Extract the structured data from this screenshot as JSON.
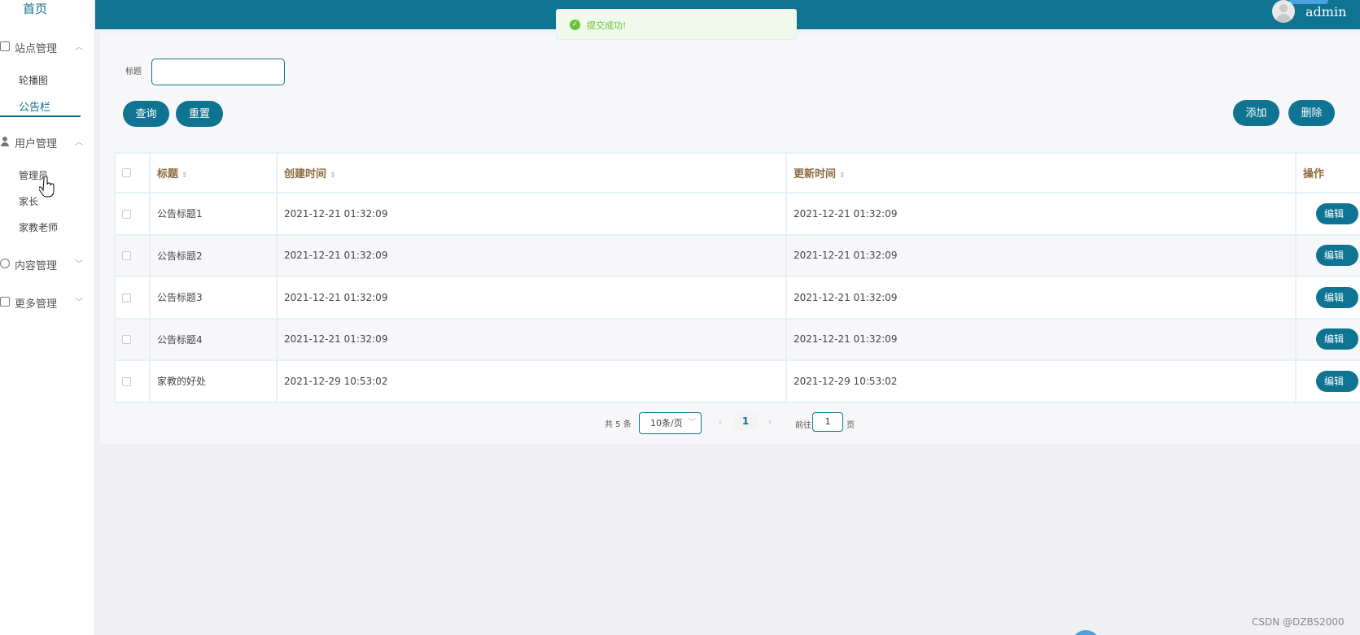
{
  "sidebar": {
    "home": "首页",
    "groups": [
      {
        "label": "站点管理",
        "items": [
          "轮播图",
          "公告栏"
        ]
      },
      {
        "label": "用户管理",
        "items": [
          "管理员",
          "家长",
          "家教老师"
        ]
      },
      {
        "label": "内容管理"
      },
      {
        "label": "更多管理"
      }
    ],
    "active_item": "公告栏"
  },
  "header": {
    "username": "admin"
  },
  "toast": {
    "message": "提交成功!"
  },
  "search": {
    "title_label": "标题",
    "title_value": "",
    "query_button": "查询",
    "reset_button": "重置"
  },
  "actions": {
    "add_button": "添加",
    "delete_button": "删除"
  },
  "table": {
    "headers": [
      "标题",
      "创建时间",
      "更新时间",
      "操作"
    ],
    "rows": [
      {
        "title": "公告标题1",
        "created": "2021-12-21 01:32:09",
        "updated": "2021-12-21 01:32:09"
      },
      {
        "title": "公告标题2",
        "created": "2021-12-21 01:32:09",
        "updated": "2021-12-21 01:32:09"
      },
      {
        "title": "公告标题3",
        "created": "2021-12-21 01:32:09",
        "updated": "2021-12-21 01:32:09"
      },
      {
        "title": "公告标题4",
        "created": "2021-12-21 01:32:09",
        "updated": "2021-12-21 01:32:09"
      },
      {
        "title": "家教的好处",
        "created": "2021-12-29 10:53:02",
        "updated": "2021-12-29 10:53:02"
      }
    ],
    "edit_label": "编辑"
  },
  "pagination": {
    "total": "共 5 条",
    "page_size": "10条/页",
    "current_page": "1",
    "goto_label": "前往",
    "goto_value": "1",
    "page_suffix": "页"
  },
  "watermark": "CSDN @DZBS2000",
  "colors": {
    "primary": "#0e7491",
    "success": "#67c23a"
  }
}
